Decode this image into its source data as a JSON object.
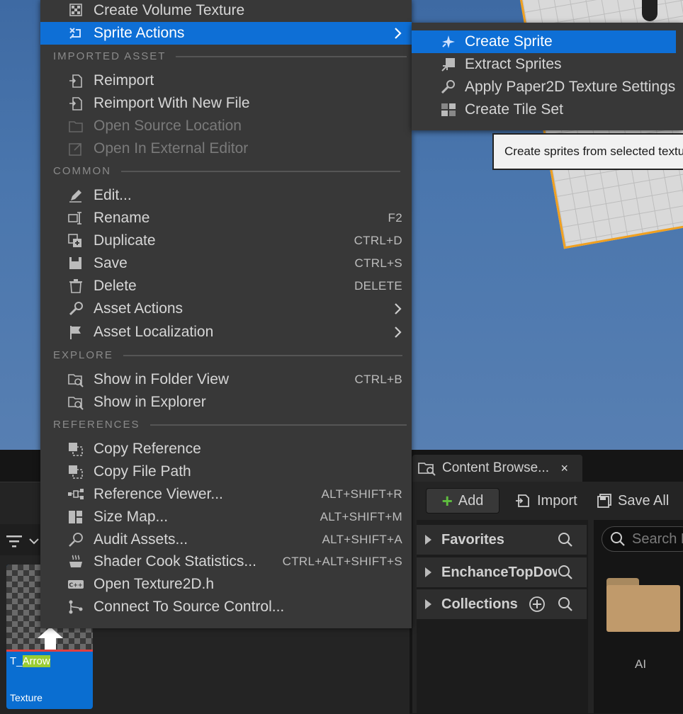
{
  "menu": {
    "items_top": [
      {
        "label": "Create Volume Texture"
      },
      {
        "label": "Sprite Actions"
      }
    ],
    "section_imported": "IMPORTED ASSET",
    "imported": [
      {
        "label": "Reimport"
      },
      {
        "label": "Reimport With New File"
      },
      {
        "label": "Open Source Location"
      },
      {
        "label": "Open In External Editor"
      }
    ],
    "section_common": "COMMON",
    "common": [
      {
        "label": "Edit...",
        "shortcut": ""
      },
      {
        "label": "Rename",
        "shortcut": "F2"
      },
      {
        "label": "Duplicate",
        "shortcut": "CTRL+D"
      },
      {
        "label": "Save",
        "shortcut": "CTRL+S"
      },
      {
        "label": "Delete",
        "shortcut": "DELETE"
      },
      {
        "label": "Asset Actions",
        "shortcut": ""
      },
      {
        "label": "Asset Localization",
        "shortcut": ""
      }
    ],
    "section_explore": "EXPLORE",
    "explore": [
      {
        "label": "Show in Folder View",
        "shortcut": "CTRL+B"
      },
      {
        "label": "Show in Explorer",
        "shortcut": ""
      }
    ],
    "section_references": "REFERENCES",
    "references": [
      {
        "label": "Copy Reference",
        "shortcut": ""
      },
      {
        "label": "Copy File Path",
        "shortcut": ""
      },
      {
        "label": "Reference Viewer...",
        "shortcut": "ALT+SHIFT+R"
      },
      {
        "label": "Size Map...",
        "shortcut": "ALT+SHIFT+M"
      },
      {
        "label": "Audit Assets...",
        "shortcut": "ALT+SHIFT+A"
      },
      {
        "label": "Shader Cook Statistics...",
        "shortcut": "CTRL+ALT+SHIFT+S"
      },
      {
        "label": "Open Texture2D.h",
        "shortcut": ""
      },
      {
        "label": "Connect To Source Control...",
        "shortcut": ""
      }
    ]
  },
  "submenu": {
    "items": [
      {
        "label": "Create Sprite"
      },
      {
        "label": "Extract Sprites"
      },
      {
        "label": "Apply Paper2D Texture Settings"
      },
      {
        "label": "Create Tile Set"
      }
    ],
    "tooltip": "Create sprites from selected textures"
  },
  "asset": {
    "name_prefix": "T_",
    "name_highlight": "Arrow",
    "type": "Texture"
  },
  "content_browser": {
    "tab_title": "Content Browse...",
    "close_glyph": "×",
    "add_label": "Add",
    "import_label": "Import",
    "save_all_label": "Save All",
    "tree": [
      {
        "label": "Favorites"
      },
      {
        "label": "EnchanceTopDow"
      },
      {
        "label": "Collections"
      }
    ],
    "search_placeholder": "Search EnchanceTopDown",
    "folder_label": "AI"
  },
  "colors": {
    "accent": "#0e6fd6",
    "menu_bg": "#383838",
    "highlight": "#9acd32"
  }
}
